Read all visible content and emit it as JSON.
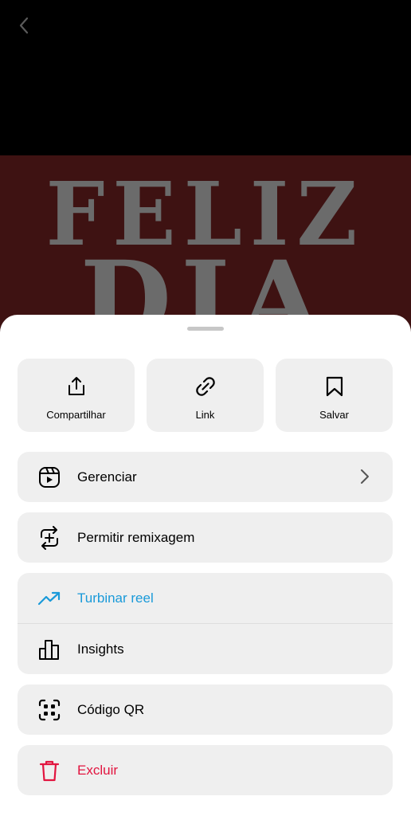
{
  "video": {
    "line1": "FELIZ",
    "line2": "DIA"
  },
  "actions": [
    {
      "label": "Compartilhar",
      "icon": "share-icon"
    },
    {
      "label": "Link",
      "icon": "link-icon"
    },
    {
      "label": "Salvar",
      "icon": "bookmark-icon"
    }
  ],
  "menu": {
    "manage": "Gerenciar",
    "remix": "Permitir remixagem",
    "boost": "Turbinar reel",
    "insights": "Insights",
    "qr": "Código QR",
    "delete": "Excluir"
  },
  "colors": {
    "boost": "#1a9ad9",
    "delete": "#e2143f",
    "card": "#efefef",
    "video_bg": "#3e1212"
  }
}
